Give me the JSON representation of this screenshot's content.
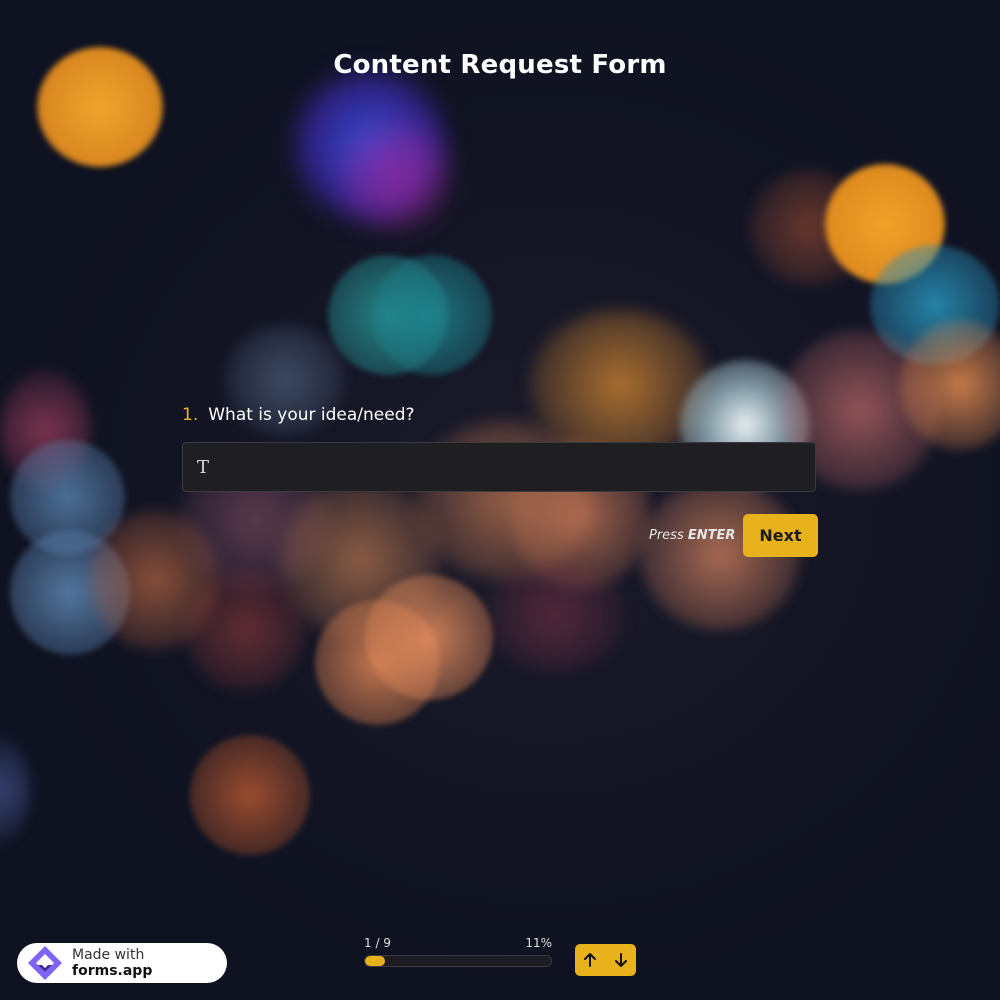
{
  "form": {
    "title": "Content Request Form"
  },
  "question": {
    "number": "1.",
    "text": "What is your idea/need?",
    "input_icon": "text-type-icon",
    "input_value": "",
    "input_placeholder": ""
  },
  "actions": {
    "hint_press": "Press",
    "hint_key": "ENTER",
    "next_label": "Next"
  },
  "footer": {
    "badge_prefix": "Made with",
    "badge_brand": "forms.app",
    "progress_step": "1 / 9",
    "progress_percent": "11%",
    "progress_fraction": 0.11,
    "nav_up_icon": "arrow-up-icon",
    "nav_down_icon": "arrow-down-icon"
  },
  "colors": {
    "accent": "#e8b21c",
    "number_color": "#e8b42a",
    "background": "#0f1221",
    "input_bg": "#1f1f22"
  }
}
